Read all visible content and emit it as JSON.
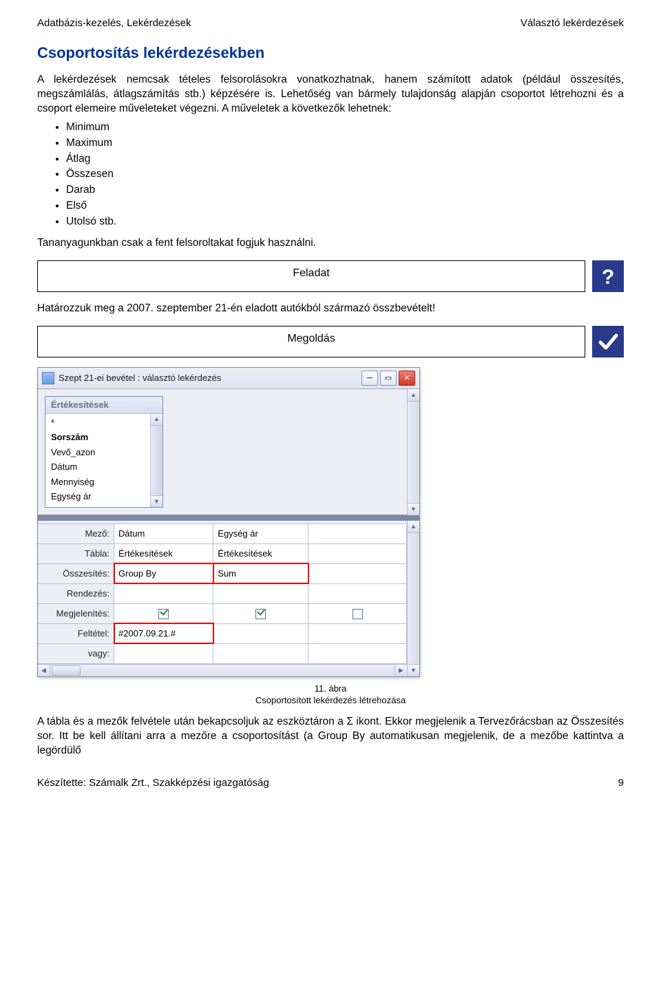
{
  "header": {
    "left": "Adatbázis-kezelés, Lekérdezések",
    "right": "Választó lekérdezések"
  },
  "section_title": "Csoportosítás lekérdezésekben",
  "paragraphs": {
    "p1": "A lekérdezések nemcsak tételes felsorolásokra vonatkozhatnak, hanem számított adatok (például összesítés, megszámlálás, átlagszámítás stb.) képzésére is. Lehetőség van bármely tulajdonság alapján csoportot létrehozni és a csoport elemeire műveleteket végezni. A műveletek a következők lehetnek:",
    "p2": "Tananyagunkban csak a fent felsoroltakat fogjuk használni.",
    "task_desc": "Határozzuk meg a 2007. szeptember 21-én eladott autókból származó összbevételt!",
    "p3": "A tábla és a mezők felvétele után bekapcsoljuk az eszköztáron a Σ ikont. Ekkor megjelenik a Tervezőrácsban az Összesítés sor. Itt be kell állítani arra a mezőre a csoportosítást (a Group By automatikusan megjelenik, de a mezőbe kattintva a legördülő"
  },
  "bullets": [
    "Minimum",
    "Maximum",
    "Átlag",
    "Összesen",
    "Darab",
    "Első",
    "Utolsó stb."
  ],
  "task_label": "Feladat",
  "solution_label": "Megoldás",
  "screenshot": {
    "title": "Szept 21-ei bevétel : választó lekérdezés",
    "table_box_title": "Értékesítések",
    "fields": [
      "*",
      "Sorszám",
      "Vevő_azon",
      "Dátum",
      "Mennyiség",
      "Egység ár"
    ],
    "grid_labels": {
      "mezo": "Mező:",
      "tabla": "Tábla:",
      "osszesites": "Összesítés:",
      "rendezes": "Rendezés:",
      "megjelenites": "Megjelenítés:",
      "feltetel": "Feltétel:",
      "vagy": "vagy:"
    },
    "grid": {
      "mezo": [
        "Dátum",
        "Egység ár",
        ""
      ],
      "tabla": [
        "Értékesítések",
        "Értékesítések",
        ""
      ],
      "osszesites": [
        "Group By",
        "Sum",
        ""
      ],
      "feltetel": [
        "#2007.09.21.#",
        "",
        ""
      ]
    }
  },
  "caption": {
    "num": "11. ábra",
    "text": "Csoportosított lekérdezés létrehozása"
  },
  "footer": {
    "left": "Készítette: Számalk Zrt., Szakképzési igazgatóság",
    "right": "9"
  }
}
